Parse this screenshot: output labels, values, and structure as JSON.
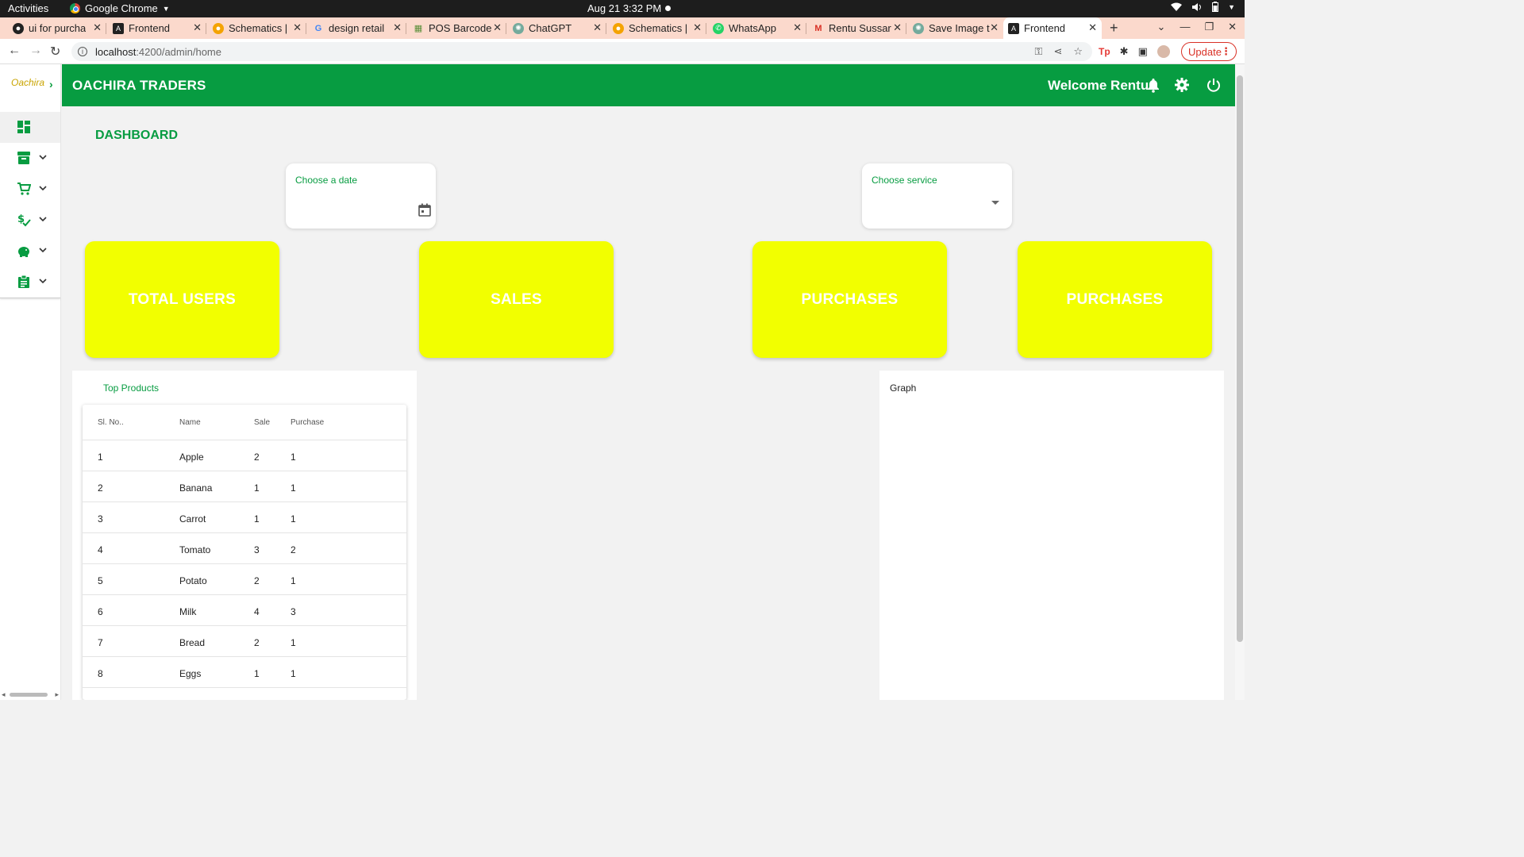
{
  "os": {
    "activities": "Activities",
    "app_menu": "Google Chrome",
    "clock": "Aug 21  3:32 PM"
  },
  "browser": {
    "tabs": [
      {
        "label": "ui for purcha",
        "icon": "github-icon"
      },
      {
        "label": "Frontend",
        "icon": "angular-icon"
      },
      {
        "label": "Schematics |",
        "icon": "schematics-icon"
      },
      {
        "label": "design retail",
        "icon": "google-icon"
      },
      {
        "label": "POS Barcode",
        "icon": "barcode-icon"
      },
      {
        "label": "ChatGPT",
        "icon": "chatgpt-icon"
      },
      {
        "label": "Schematics |",
        "icon": "schematics-icon"
      },
      {
        "label": "WhatsApp",
        "icon": "whatsapp-icon"
      },
      {
        "label": "Rentu Sussar",
        "icon": "gmail-icon"
      },
      {
        "label": "Save Image t",
        "icon": "chatgpt-icon"
      },
      {
        "label": "Frontend",
        "icon": "angular-icon"
      }
    ],
    "url_host": "localhost",
    "url_path": ":4200/admin/home",
    "update_label": "Update"
  },
  "app": {
    "brand": "Oachira",
    "title": "OACHIRA TRADERS",
    "welcome": "Welcome Rentu",
    "accent": "#079c41",
    "card_color": "#f2ff00"
  },
  "sidebar": {
    "items": [
      {
        "icon": "dashboard-icon",
        "expandable": false
      },
      {
        "icon": "inventory-icon",
        "expandable": true
      },
      {
        "icon": "cart-icon",
        "expandable": true
      },
      {
        "icon": "price-check-icon",
        "expandable": true
      },
      {
        "icon": "savings-icon",
        "expandable": true
      },
      {
        "icon": "assignment-icon",
        "expandable": true
      }
    ]
  },
  "dashboard": {
    "title": "DASHBOARD",
    "date_field_label": "Choose a date",
    "service_field_label": "Choose service",
    "cards": [
      "TOTAL USERS",
      "SALES",
      "PURCHASES",
      "PURCHASES"
    ],
    "top_products_title": "Top Products",
    "graph_title": "Graph",
    "table": {
      "headers": [
        "Sl. No..",
        "Name",
        "Sale",
        "Purchase"
      ],
      "rows": [
        [
          "1",
          "Apple",
          "2",
          "1"
        ],
        [
          "2",
          "Banana",
          "1",
          "1"
        ],
        [
          "3",
          "Carrot",
          "1",
          "1"
        ],
        [
          "4",
          "Tomato",
          "3",
          "2"
        ],
        [
          "5",
          "Potato",
          "2",
          "1"
        ],
        [
          "6",
          "Milk",
          "4",
          "3"
        ],
        [
          "7",
          "Bread",
          "2",
          "1"
        ],
        [
          "8",
          "Eggs",
          "1",
          "1"
        ]
      ]
    }
  }
}
